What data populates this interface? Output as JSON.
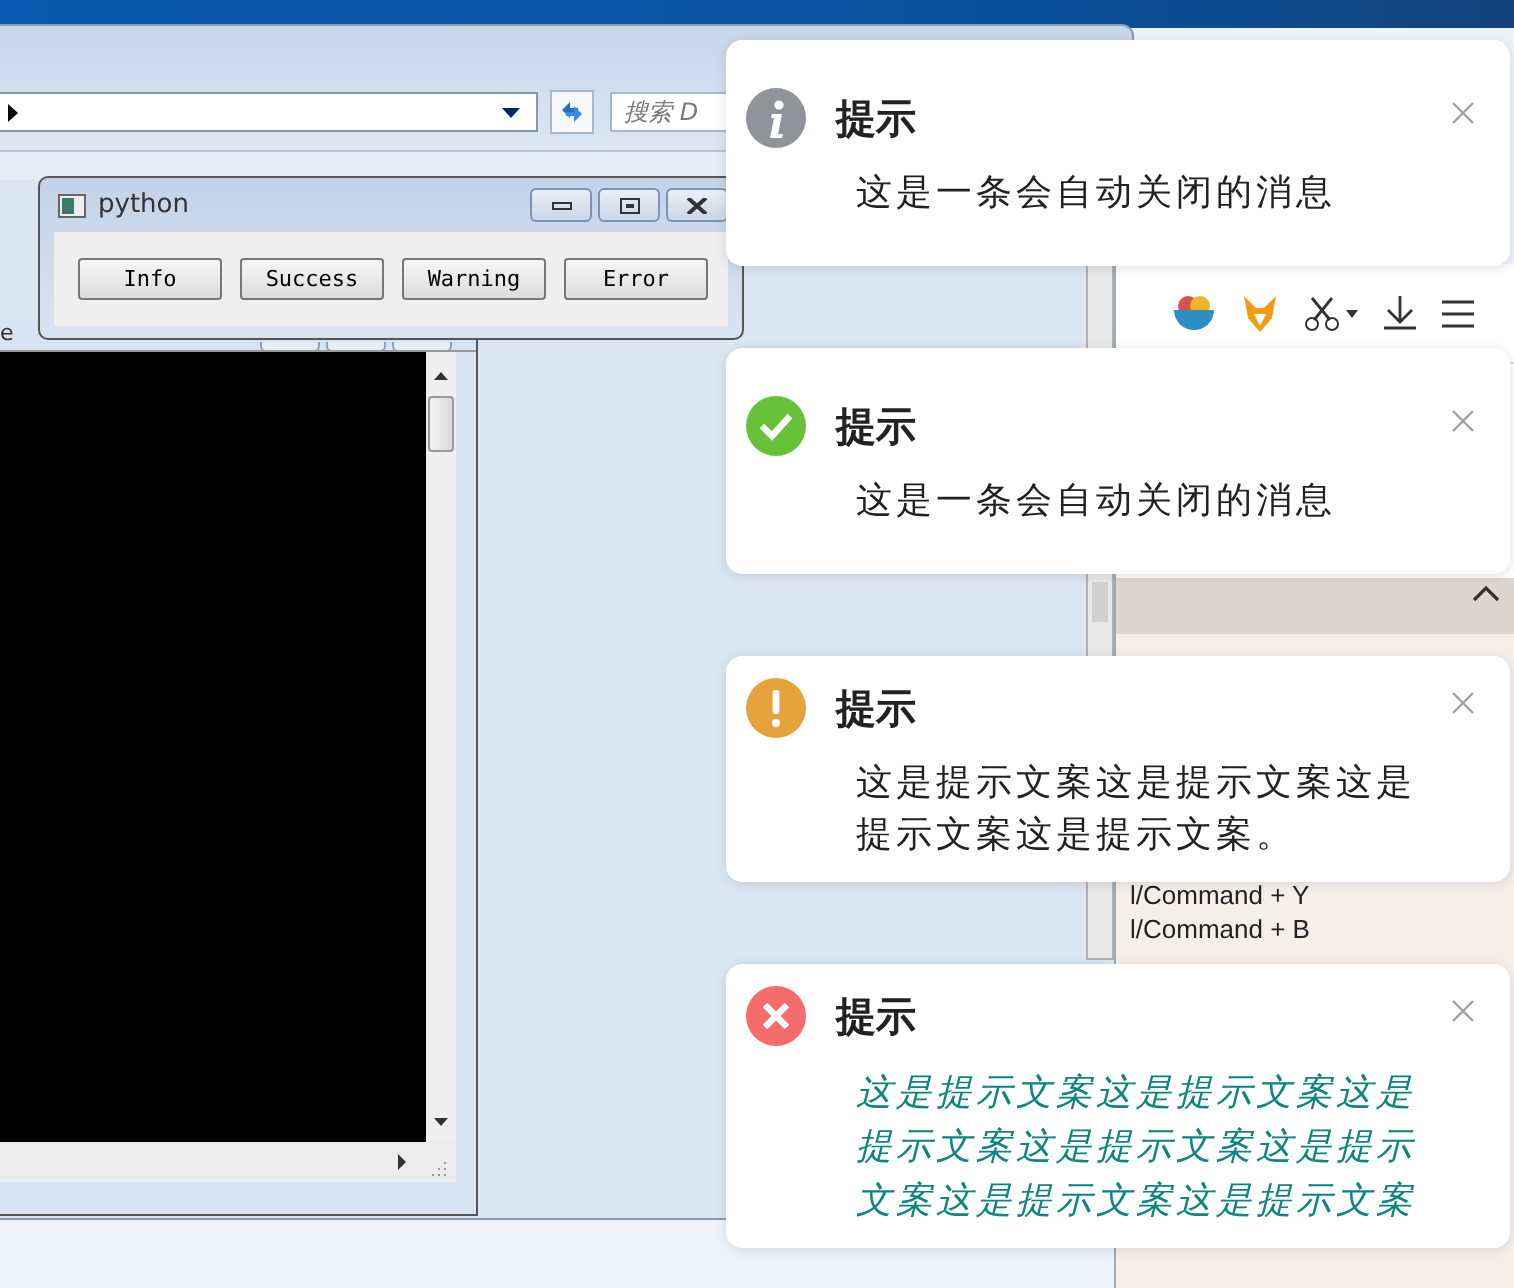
{
  "explorer": {
    "search": {
      "placeholder": "搜索 D"
    }
  },
  "console": {
    "title": "e"
  },
  "python_window": {
    "title": "python",
    "buttons": [
      "Info",
      "Success",
      "Warning",
      "Error"
    ]
  },
  "browser": {
    "shortcuts": [
      "l/Command + Y",
      "l/Command + B"
    ]
  },
  "notifications": [
    {
      "kind": "info",
      "title": "提示",
      "message": "这是一条会自动关闭的消息",
      "highlighted": false
    },
    {
      "kind": "success",
      "title": "提示",
      "message": "这是一条会自动关闭的消息",
      "highlighted": false
    },
    {
      "kind": "warning",
      "title": "提示",
      "message": "这是提示文案这是提示文案这是提示文案这是提示文案。",
      "highlighted": false
    },
    {
      "kind": "error",
      "title": "提示",
      "message": "这是提示文案这是提示文案这是提示文案这是提示文案这是提示文案这是提示文案这是提示文案",
      "highlighted": true
    }
  ]
}
